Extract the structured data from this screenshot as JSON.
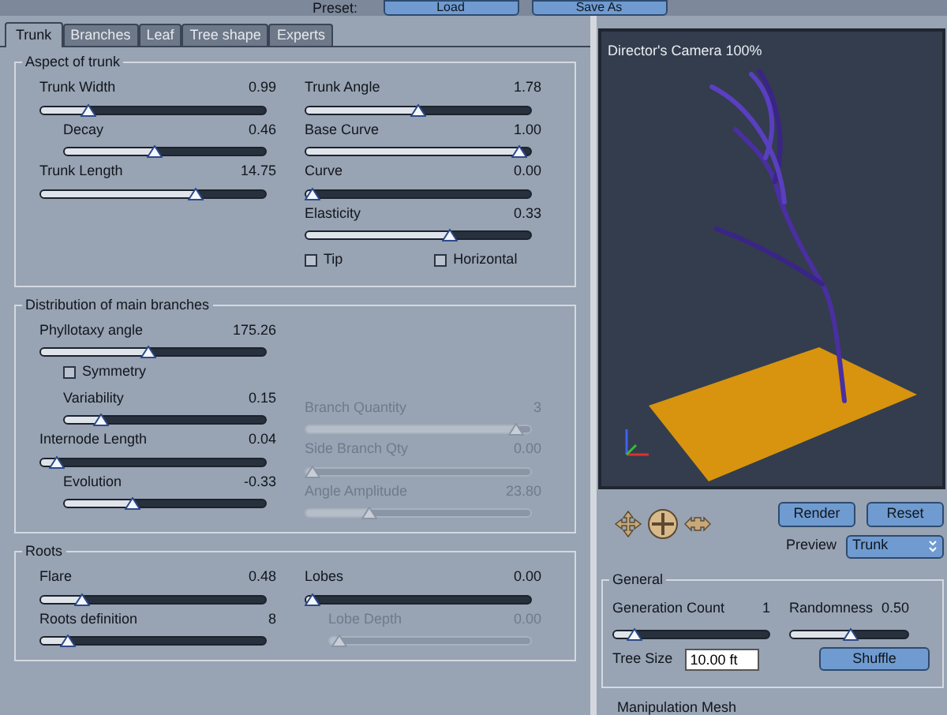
{
  "preset": {
    "label": "Preset:",
    "buttons": [
      "Load",
      "Save As"
    ]
  },
  "tabs": [
    {
      "label": "Trunk",
      "selected": true
    },
    {
      "label": "Branches",
      "selected": false
    },
    {
      "label": "Leaf",
      "selected": false
    },
    {
      "label": "Tree shape",
      "selected": false
    },
    {
      "label": "Experts",
      "selected": false
    }
  ],
  "sections": [
    {
      "title": "Aspect of trunk",
      "left": [
        {
          "kind": "slider",
          "label": "Trunk Width",
          "value": "0.99",
          "level": 0.21,
          "disabled": false
        },
        {
          "kind": "sub_slider",
          "label": "Decay",
          "value": "0.46",
          "level": 0.45,
          "disabled": false
        },
        {
          "kind": "slider",
          "label": "Trunk Length",
          "value": "14.75",
          "level": 0.69,
          "disabled": false
        }
      ],
      "right": [
        {
          "kind": "slider",
          "label": "Trunk Angle",
          "value": "1.78",
          "level": 0.5,
          "disabled": false
        },
        {
          "kind": "slider",
          "label": "Base Curve",
          "value": "1.00",
          "level": 0.95,
          "disabled": false
        },
        {
          "kind": "slider",
          "label": "Curve",
          "value": "0.00",
          "level": 0.03,
          "disabled": false
        },
        {
          "kind": "slider",
          "label": "Elasticity",
          "value": "0.33",
          "level": 0.64,
          "disabled": false
        },
        {
          "kind": "checkboxes",
          "items": [
            {
              "label": "Tip",
              "checked": false
            },
            {
              "label": "Horizontal",
              "checked": false
            }
          ]
        }
      ]
    },
    {
      "title": "Distribution of main branches",
      "left": [
        {
          "kind": "slider",
          "label": "Phyllotaxy angle",
          "value": "175.26",
          "level": 0.48,
          "disabled": false
        },
        {
          "kind": "sub_checkbox",
          "label": "Symmetry",
          "checked": false
        },
        {
          "kind": "sub_slider",
          "label": "Variability",
          "value": "0.15",
          "level": 0.18,
          "disabled": false
        },
        {
          "kind": "slider",
          "label": "Internode Length",
          "value": "0.04",
          "level": 0.07,
          "disabled": false
        },
        {
          "kind": "sub_slider",
          "label": "Evolution",
          "value": "-0.33",
          "level": 0.34,
          "disabled": false
        }
      ],
      "right": [
        {
          "kind": "spacer"
        },
        {
          "kind": "slider",
          "label": "Branch Quantity",
          "value": "3",
          "level": 0.94,
          "disabled": true
        },
        {
          "kind": "slider",
          "label": "Side Branch Qty",
          "value": "0.00",
          "level": 0.03,
          "disabled": true
        },
        {
          "kind": "slider",
          "label": "Angle Amplitude",
          "value": "23.80",
          "level": 0.28,
          "disabled": true
        }
      ]
    },
    {
      "title": "Roots",
      "left": [
        {
          "kind": "slider",
          "label": "Flare",
          "value": "0.48",
          "level": 0.18,
          "disabled": false
        },
        {
          "kind": "slider",
          "label": "Roots definition",
          "value": "8",
          "level": 0.12,
          "disabled": false
        }
      ],
      "right": [
        {
          "kind": "slider",
          "label": "Lobes",
          "value": "0.00",
          "level": 0.03,
          "disabled": false
        },
        {
          "kind": "sub_slider",
          "label": "Lobe Depth",
          "value": "0.00",
          "level": 0.05,
          "disabled": true
        }
      ]
    }
  ],
  "viewport": {
    "title": "Director's Camera 100%"
  },
  "actions": [
    "Render",
    "Reset"
  ],
  "preview": {
    "label": "Preview",
    "value": "Trunk"
  },
  "general": {
    "title": "General",
    "sliders": [
      {
        "label": "Generation Count",
        "value": "1",
        "level": 0.13
      },
      {
        "label": "Randomness",
        "value": "0.50",
        "level": 0.51
      }
    ],
    "tree_size": {
      "label": "Tree Size",
      "value": "10.00 ft"
    },
    "shuffle": "Shuffle"
  },
  "next_section": "Manipulation Mesh"
}
